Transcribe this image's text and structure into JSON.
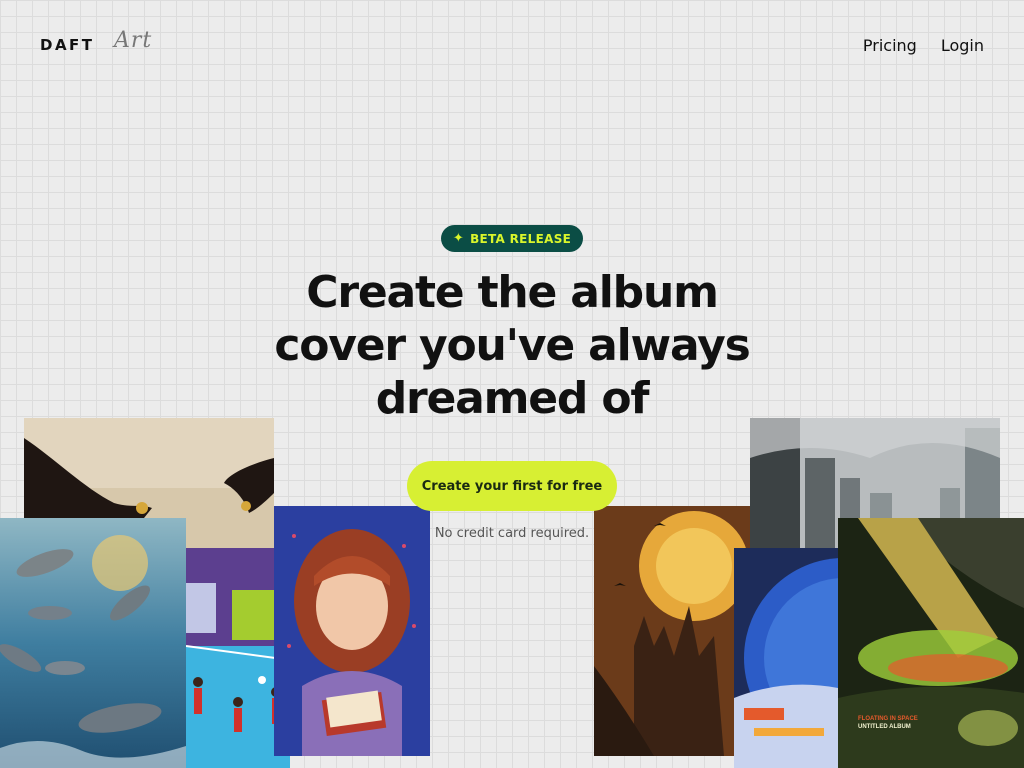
{
  "logo": {
    "primary": "DAFT",
    "script": "Art"
  },
  "nav": {
    "links": [
      "Pricing",
      "Login"
    ]
  },
  "hero": {
    "badge_icon": "sparkle-icon",
    "badge": "BETA RELEASE",
    "headline": "Create the album cover you've always dreamed of",
    "cta": "Create your first for free",
    "note": "No credit card required."
  },
  "gallery": {
    "album_text_1": "FLOATING IN SPACE",
    "album_text_2": "UNTITLED ALBUM"
  },
  "colors": {
    "badge_bg": "#0b4d45",
    "badge_text": "#d9f52b",
    "cta_bg": "#d7ef33",
    "page_bg": "#ececec"
  }
}
